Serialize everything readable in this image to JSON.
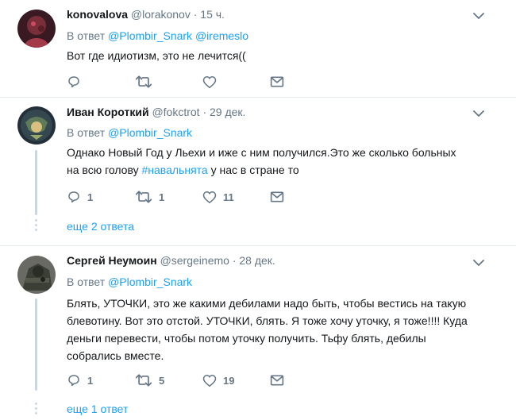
{
  "tweets": [
    {
      "name": "konovalova",
      "handle": "@lorakonov",
      "time": "· 15 ч.",
      "reply_prefix": "В ответ",
      "reply_to_1": "@Plombir_Snark",
      "reply_to_2": "@iremeslo",
      "text": "Вот где идиотизм, это не лечится(("
    },
    {
      "name": "Иван Короткий",
      "handle": "@fokctrot",
      "time": "· 29 дек.",
      "reply_prefix": "В ответ",
      "reply_to_1": "@Plombir_Snark",
      "text_line1": "Однако Новый Год у Льехи и иже с ним получился.Это же сколько больных",
      "text_line2_a": "на всю голову ",
      "hashtag": "#навальнята",
      "text_line2_b": " у нас в стране то",
      "replies": "1",
      "retweets": "1",
      "likes": "11",
      "more_replies": "еще 2 ответа"
    },
    {
      "name": "Сергей Неумоин",
      "handle": "@sergeinemo",
      "time": "· 28 дек.",
      "reply_prefix": "В ответ",
      "reply_to_1": "@Plombir_Snark",
      "text_line1": "Блять, УТОЧКИ, это же какими дебилами надо быть, чтобы вестись на такую",
      "text_line2": "блевотину. Вот это отстой. УТОЧКИ, блять. Я тоже хочу уточку, я тоже!!!! Куда",
      "text_line3": "деньги перевести, чтобы потом уточку получить. Тьфу блять, дебилы",
      "text_line4": "собрались вместе.",
      "replies": "1",
      "retweets": "5",
      "likes": "19",
      "more_replies": "еще 1 ответ"
    }
  ],
  "colors": {
    "link": "#1da1f2",
    "muted": "#657786",
    "icon": "#657786",
    "divider": "#e6ecf0"
  },
  "icons": [
    "reply-icon",
    "retweet-icon",
    "like-icon",
    "dm-icon",
    "chevron-down-icon"
  ]
}
